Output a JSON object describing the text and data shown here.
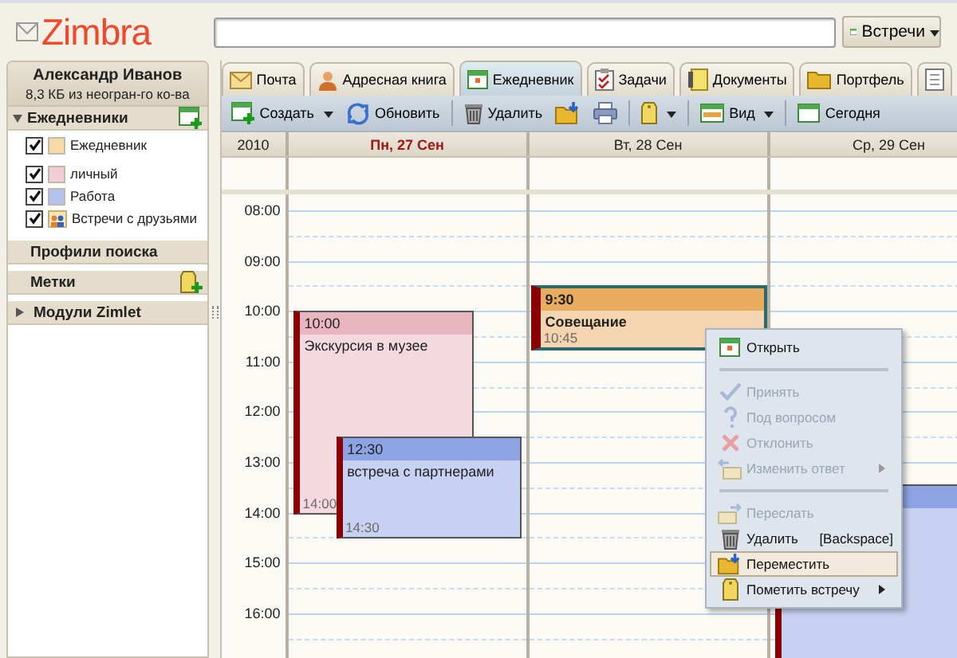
{
  "header": {
    "logo": "Zimbra",
    "search_scope": "Встречи"
  },
  "account": {
    "name": "Александр Иванов",
    "quota": "8,3 КБ из неогран-го ко-ва"
  },
  "sidebar": {
    "sections": [
      {
        "kind": "calendars",
        "title": "Ежедневники",
        "expanded": true,
        "items": [
          {
            "kind": "calendar",
            "label": "Ежедневник",
            "checked": true,
            "color": "#f5d9a6"
          },
          {
            "kind": "calendar",
            "label": "личный",
            "checked": true,
            "color": "#f2cdd6"
          },
          {
            "kind": "calendar",
            "label": "Работа",
            "checked": true,
            "color": "#b3c3ee"
          },
          {
            "kind": "shared",
            "label": "Встречи с друзьями",
            "checked": true
          }
        ]
      },
      {
        "kind": "searches",
        "title": "Профили поиска"
      },
      {
        "kind": "tags",
        "title": "Метки"
      },
      {
        "kind": "zimlets",
        "title": "Модули Zimlet",
        "expanded": false
      }
    ]
  },
  "tabs": [
    {
      "kind": "mail",
      "label": "Почта",
      "selected": false
    },
    {
      "kind": "contacts",
      "label": "Адресная книга",
      "selected": false
    },
    {
      "kind": "calendar",
      "label": "Ежедневник",
      "selected": true
    },
    {
      "kind": "tasks",
      "label": "Задачи",
      "selected": false
    },
    {
      "kind": "documents",
      "label": "Документы",
      "selected": false
    },
    {
      "kind": "briefcase",
      "label": "Портфель",
      "selected": false
    },
    {
      "kind": "notes",
      "selected": false
    }
  ],
  "toolbar": [
    {
      "kind": "create",
      "label": "Создать",
      "dropdown": true
    },
    {
      "kind": "refresh",
      "label": "Обновить",
      "dropdown": false
    },
    {
      "kind": "separator"
    },
    {
      "kind": "delete",
      "label": "Удалить",
      "dropdown": false
    },
    {
      "kind": "move",
      "dropdown": false
    },
    {
      "kind": "print",
      "dropdown": false
    },
    {
      "kind": "separator"
    },
    {
      "kind": "tag",
      "dropdown": true
    },
    {
      "kind": "separator"
    },
    {
      "kind": "view",
      "label": "Вид",
      "dropdown": true
    },
    {
      "kind": "separator"
    },
    {
      "kind": "today",
      "label": "Сегодня",
      "dropdown": false
    }
  ],
  "calendar": {
    "year": "2010",
    "hours": [
      "08:00",
      "09:00",
      "10:00",
      "11:00",
      "12:00",
      "13:00",
      "14:00",
      "15:00",
      "16:00"
    ],
    "days": [
      {
        "label": "Пн, 27 Сен",
        "today": true,
        "events": [
          {
            "kind": "timed",
            "start": "10:00",
            "end": "14:00",
            "title": "Экскурсия в музее",
            "color": "#e9b5c1",
            "selected": false
          },
          {
            "kind": "timed",
            "start": "12:30",
            "end": "14:30",
            "title": "встреча с партнерами",
            "color": "#8ea3e3",
            "selected": false
          }
        ]
      },
      {
        "label": "Вт, 28 Сен",
        "today": false,
        "events": [
          {
            "kind": "timed",
            "start": "9:30",
            "end": "10:45",
            "title": "Совещание",
            "color": "#e8ab5f",
            "selected": true
          }
        ]
      },
      {
        "label": "Ср, 29 Сен",
        "today": false,
        "events": [
          {
            "kind": "covered",
            "color": "#8ea3e3",
            "selected": false
          }
        ]
      }
    ]
  },
  "context_menu": {
    "items": [
      {
        "kind": "open",
        "label": "Открыть",
        "disabled": false,
        "submenu": false,
        "selected": false
      },
      {
        "kind": "separator"
      },
      {
        "kind": "accept",
        "label": "Принять",
        "disabled": true,
        "submenu": false,
        "selected": false
      },
      {
        "kind": "tentative",
        "label": "Под вопросом",
        "disabled": true,
        "submenu": false,
        "selected": false
      },
      {
        "kind": "decline",
        "label": "Отклонить",
        "disabled": true,
        "submenu": false,
        "selected": false
      },
      {
        "kind": "reply",
        "label": "Изменить ответ",
        "disabled": true,
        "submenu": true,
        "selected": false
      },
      {
        "kind": "separator"
      },
      {
        "kind": "forward",
        "label": "Переслать",
        "disabled": true,
        "submenu": false,
        "selected": false
      },
      {
        "kind": "delete",
        "label": "Удалить",
        "shortcut": "[Backspace]",
        "disabled": false,
        "submenu": false,
        "selected": false
      },
      {
        "kind": "move",
        "label": "Переместить",
        "disabled": false,
        "submenu": false,
        "selected": true
      },
      {
        "kind": "tag",
        "label": "Пометить встречу",
        "disabled": false,
        "submenu": true,
        "selected": false
      }
    ]
  }
}
